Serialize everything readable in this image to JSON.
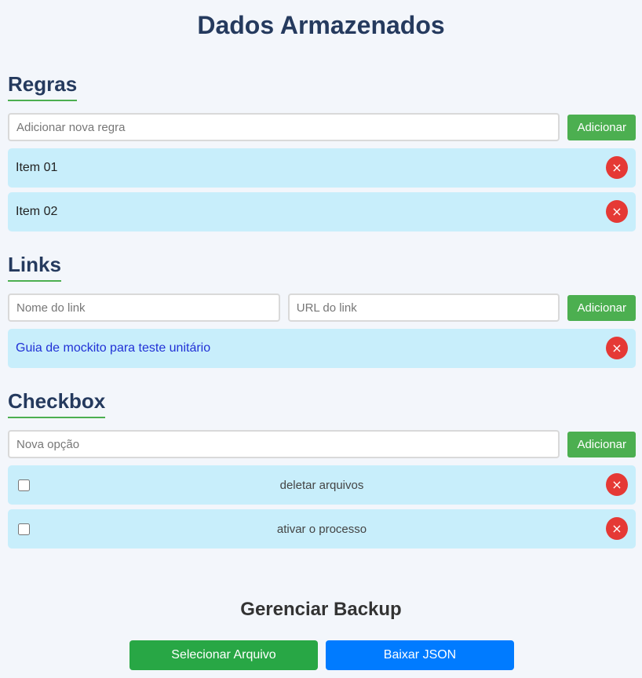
{
  "title": "Dados Armazenados",
  "rules": {
    "title": "Regras",
    "input_placeholder": "Adicionar nova regra",
    "add_label": "Adicionar",
    "items": [
      "Item 01",
      "Item 02"
    ]
  },
  "links": {
    "title": "Links",
    "name_placeholder": "Nome do link",
    "url_placeholder": "URL do link",
    "add_label": "Adicionar",
    "items": [
      {
        "label": "Guia de mockito para teste unitário"
      }
    ]
  },
  "checkbox": {
    "title": "Checkbox",
    "input_placeholder": "Nova opção",
    "add_label": "Adicionar",
    "items": [
      {
        "label": "deletar arquivos",
        "checked": false
      },
      {
        "label": "ativar o processo",
        "checked": false
      }
    ]
  },
  "delete_icon": "×",
  "backup": {
    "title": "Gerenciar Backup",
    "select_label": "Selecionar Arquivo",
    "download_label": "Baixar JSON"
  },
  "colors": {
    "accent_green": "#4caf50",
    "select_green": "#28a745",
    "download_blue": "#007bff",
    "delete_red": "#e53935",
    "item_bg": "#c8eefb",
    "heading": "#253a5e"
  }
}
